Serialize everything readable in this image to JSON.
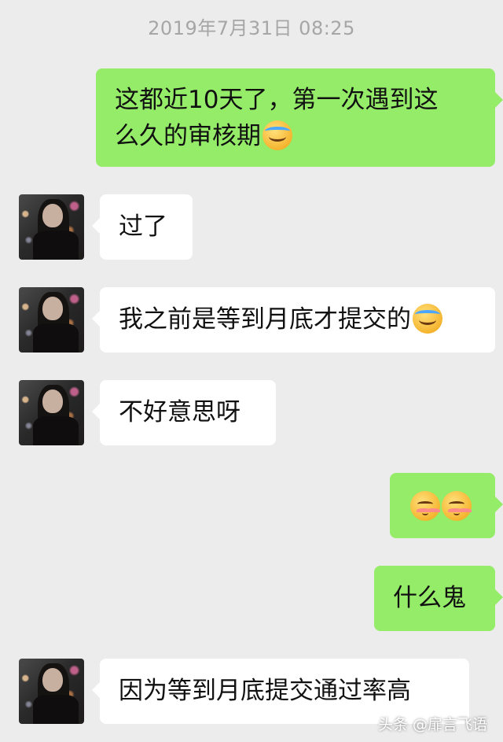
{
  "timestamp": "2019年7月31日  08:25",
  "messages": [
    {
      "side": "out",
      "text": "这都近10天了，第一次遇到这么久的审核期",
      "emoji": "crying-laughing-emoji"
    },
    {
      "side": "in",
      "text": "过了"
    },
    {
      "side": "in",
      "text": "我之前是等到月底才提交的",
      "emoji": "crying-laughing-emoji"
    },
    {
      "side": "in",
      "text": "不好意思呀"
    },
    {
      "side": "out",
      "text": "",
      "emoji": "blushing-emoji x2"
    },
    {
      "side": "out",
      "text": "什么鬼"
    },
    {
      "side": "in",
      "text": "因为等到月底提交通过率高"
    }
  ],
  "msg1_line1": "这都近10天了，第一次遇到这",
  "msg1_line2": "么久的审核期",
  "watermark": "头条 @扉言飞语",
  "colors": {
    "background": "#ececec",
    "outgoing_bubble": "#95ec69",
    "incoming_bubble": "#ffffff",
    "timestamp": "#a6a6a6"
  }
}
